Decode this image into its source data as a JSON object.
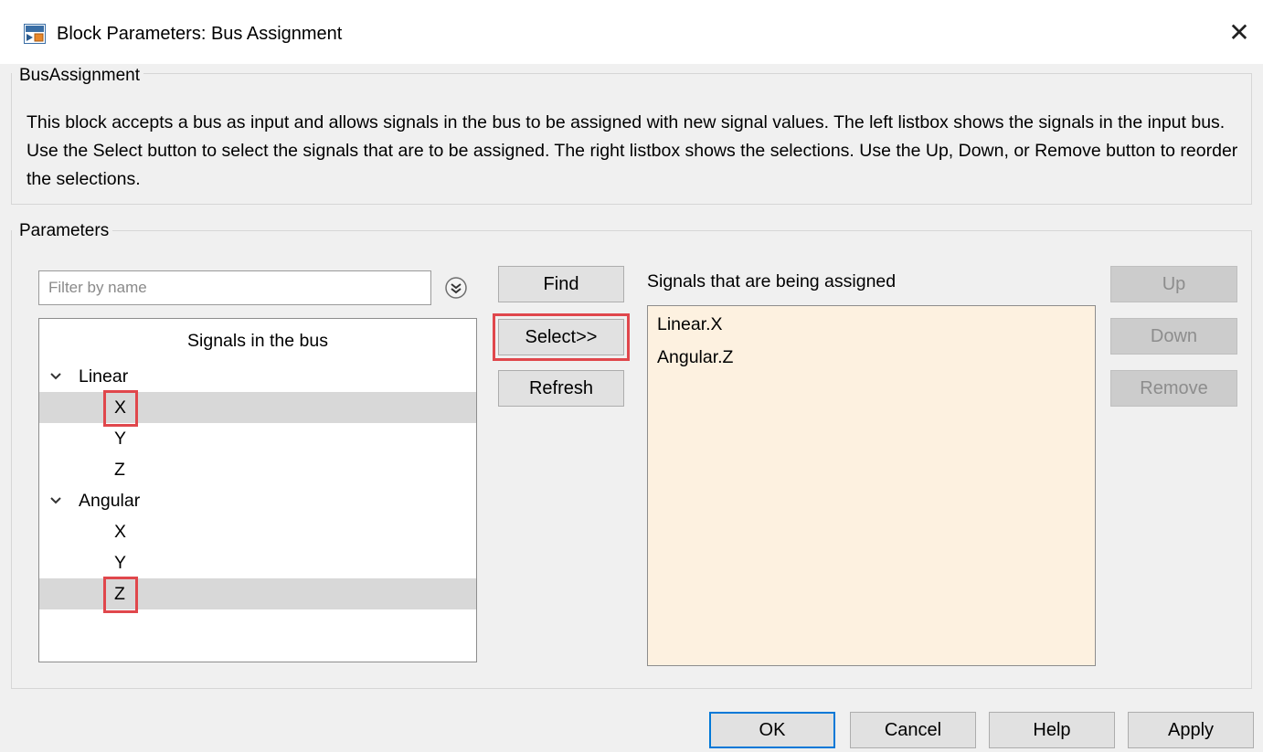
{
  "window": {
    "title": "Block Parameters: Bus Assignment",
    "close_glyph": "✕"
  },
  "description": {
    "legend": "BusAssignment",
    "text": "This block accepts a bus as input and allows signals in the bus to be assigned with new signal values. The left listbox shows the signals in the input bus. Use the Select button to select the signals that are to be assigned. The right listbox shows the selections. Use the Up, Down, or Remove button to reorder the selections."
  },
  "parameters": {
    "legend": "Parameters",
    "filter": {
      "placeholder": "Filter by name",
      "value": ""
    },
    "tree": {
      "header": "Signals in the bus",
      "groups": [
        {
          "label": "Linear",
          "expanded": true,
          "children": [
            "X",
            "Y",
            "Z"
          ],
          "selected": [
            "X"
          ]
        },
        {
          "label": "Angular",
          "expanded": true,
          "children": [
            "X",
            "Y",
            "Z"
          ],
          "selected": [
            "Z"
          ]
        }
      ]
    },
    "buttons": {
      "find": "Find",
      "select": "Select>>",
      "refresh": "Refresh"
    },
    "assigned": {
      "label": "Signals that are being assigned",
      "items": [
        "Linear.X",
        "Angular.Z"
      ]
    },
    "order_buttons": {
      "up": "Up",
      "down": "Down",
      "remove": "Remove",
      "enabled": false
    }
  },
  "footer": {
    "ok": "OK",
    "cancel": "Cancel",
    "help": "Help",
    "apply": "Apply"
  },
  "colors": {
    "highlight": "#e0474c",
    "assigned_bg": "#fdf1e0",
    "selected_row": "#d8d8d8",
    "default_button_border": "#0078d7"
  }
}
